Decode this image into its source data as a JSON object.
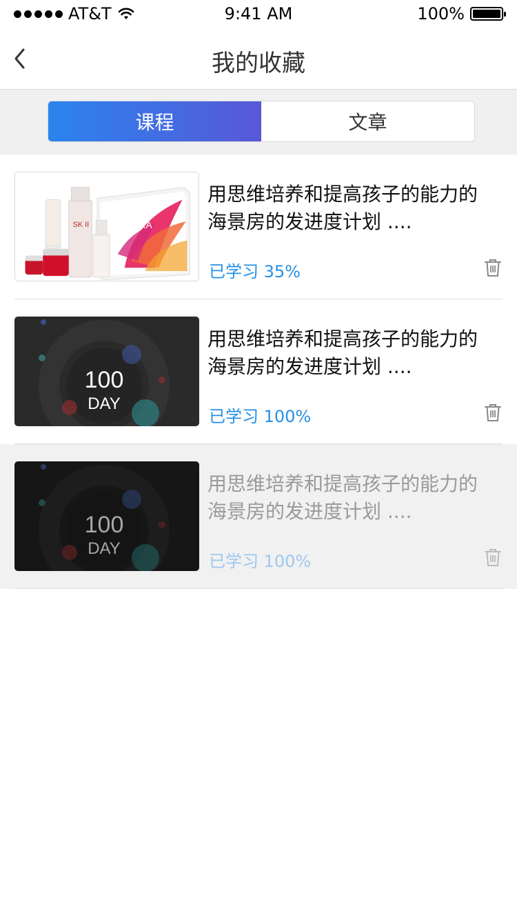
{
  "status_bar": {
    "carrier": "AT&T",
    "time": "9:41 AM",
    "battery": "100%"
  },
  "nav": {
    "title": "我的收藏",
    "back_icon": "chevron-left-icon"
  },
  "tabs": [
    {
      "label": "课程",
      "active": true
    },
    {
      "label": "文章",
      "active": false
    }
  ],
  "items": [
    {
      "title": "用思维培养和提高孩子的能力的海景房的发进度计划 ....",
      "progress": "已学习 35%",
      "thumb_brand": "SK II",
      "thumb_box_text": "PITERA"
    },
    {
      "title": "用思维培养和提高孩子的能力的海景房的发进度计划 ....",
      "progress": "已学习 100%",
      "thumb_num": "100",
      "thumb_day": "DAY"
    },
    {
      "title": "用思维培养和提高孩子的能力的海景房的发进度计划 ....",
      "progress": "已学习 100%",
      "thumb_num": "100",
      "thumb_day": "DAY"
    }
  ],
  "colors": {
    "accent": "#2590e6",
    "tab_gradient_start": "#2a84ee",
    "tab_gradient_end": "#5858d8"
  }
}
